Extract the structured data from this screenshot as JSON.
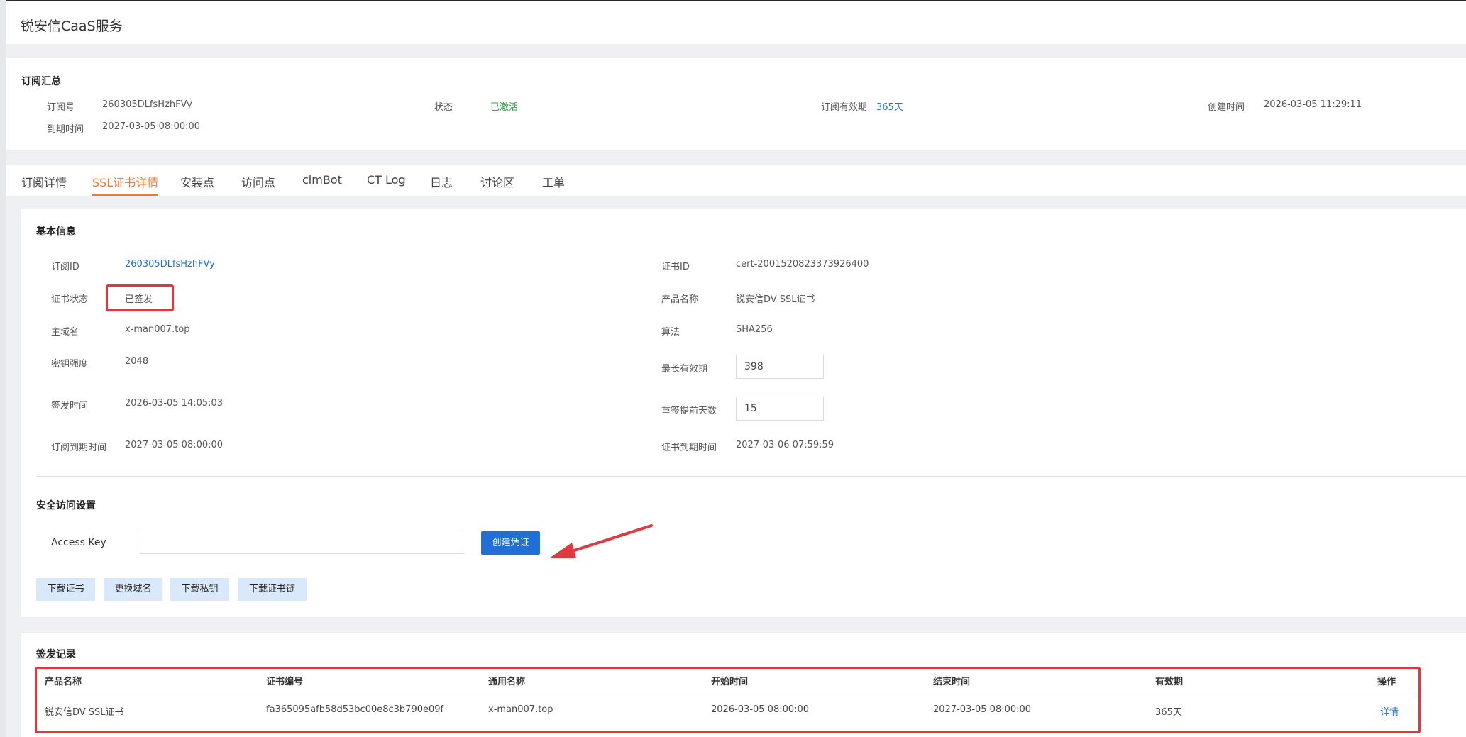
{
  "app": {
    "title": "锐安信CaaS服务"
  },
  "summary": {
    "title": "订阅汇总",
    "order_no_label": "订阅号",
    "order_no": "260305DLfsHzhFVy",
    "status_label": "状态",
    "status": "已激活",
    "validity_label": "订阅有效期",
    "validity": "365天",
    "created_label": "创建时间",
    "created": "2026-03-05 11:29:11",
    "expire_label": "到期时间",
    "expire": "2027-03-05 08:00:00"
  },
  "tabs": [
    {
      "label": "订阅详情"
    },
    {
      "label": "SSL证书详情"
    },
    {
      "label": "安装点"
    },
    {
      "label": "访问点"
    },
    {
      "label": "clmBot"
    },
    {
      "label": "CT Log"
    },
    {
      "label": "日志"
    },
    {
      "label": "讨论区"
    },
    {
      "label": "工单"
    }
  ],
  "basic": {
    "title": "基本信息",
    "subscription_id_label": "订阅ID",
    "subscription_id": "260305DLfsHzhFVy",
    "cert_status_label": "证书状态",
    "cert_status": "已签发",
    "domain_label": "主域名",
    "domain": "x-man007.top",
    "key_strength_label": "密钥强度",
    "key_strength": "2048",
    "issue_time_label": "签发时间",
    "issue_time": "2026-03-05 14:05:03",
    "sub_expire_label": "订阅到期时间",
    "sub_expire": "2027-03-05 08:00:00",
    "cert_id_label": "证书ID",
    "cert_id": "cert-2001520823373926400",
    "product_label": "产品名称",
    "product": "锐安信DV SSL证书",
    "algo_label": "算法",
    "algo": "SHA256",
    "max_valid_label": "最长有效期",
    "max_valid": "398",
    "renew_days_label": "重签提前天数",
    "renew_days": "15",
    "cert_expire_label": "证书到期时间",
    "cert_expire": "2027-03-06 07:59:59"
  },
  "security": {
    "title": "安全访问设置",
    "access_key_label": "Access Key",
    "access_key_value": "",
    "create_button": "创建凭证",
    "buttons": [
      "下载证书",
      "更换域名",
      "下载私钥",
      "下载证书链"
    ]
  },
  "records": {
    "title": "签发记录",
    "columns": [
      "产品名称",
      "证书编号",
      "通用名称",
      "开始时间",
      "结束时间",
      "有效期",
      "操作"
    ],
    "rows": [
      [
        "锐安信DV SSL证书",
        "fa365095afb58d53bc00e8c3b790e09f",
        "x-man007.top",
        "2026-03-05 08:00:00",
        "2027-03-05 08:00:00",
        "365天",
        "详情"
      ]
    ]
  },
  "colors": {
    "accent_orange": "#f07a2f",
    "primary_blue": "#1f6fd6",
    "success_green": "#22a33a",
    "highlight_red": "#e0383e"
  }
}
